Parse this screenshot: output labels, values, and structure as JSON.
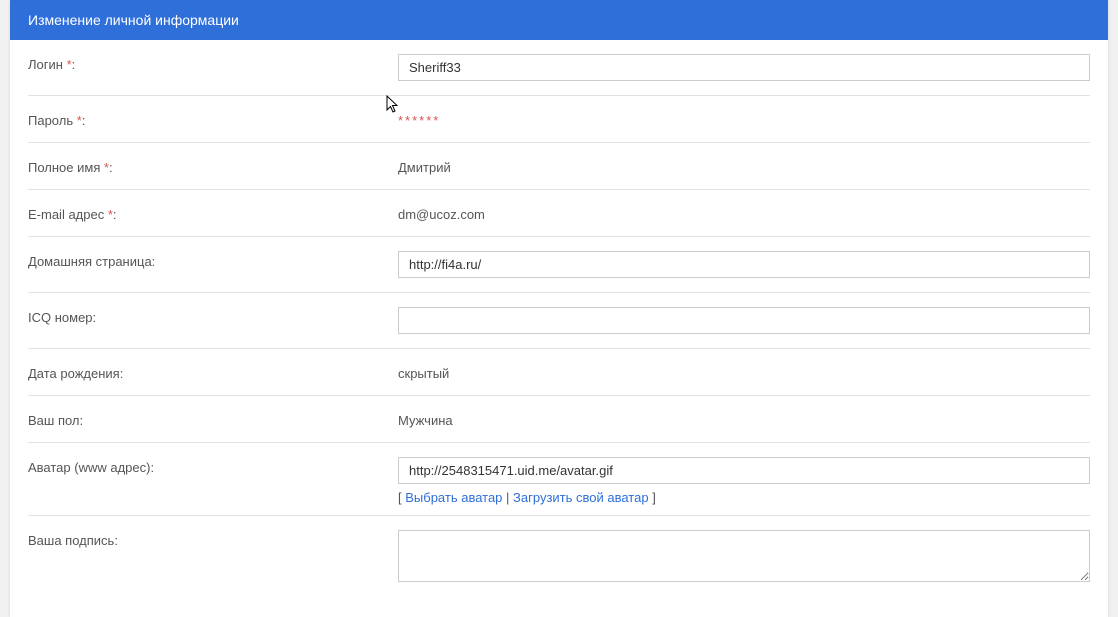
{
  "header": {
    "title": "Изменение личной информации"
  },
  "labels": {
    "login": "Логин",
    "password": "Пароль",
    "fullname": "Полное имя",
    "email": "E-mail адрес",
    "homepage": "Домашняя страница:",
    "icq": "ICQ номер:",
    "birthdate": "Дата рождения:",
    "gender": "Ваш пол:",
    "avatar": "Аватар (www адрес):",
    "signature": "Ваша подпись:",
    "star": " *",
    "colon": ":"
  },
  "values": {
    "login": "Sheriff33",
    "password_masked": "******",
    "fullname": "Дмитрий",
    "email": "dm@ucoz.com",
    "homepage": "http://fi4a.ru/",
    "icq": "",
    "birthdate": "скрытый",
    "gender": "Мужчина",
    "avatar": "http://2548315471.uid.me/avatar.gif",
    "signature": ""
  },
  "avatar_links": {
    "open_bracket": "[ ",
    "choose": "Выбрать аватар",
    "sep": " | ",
    "upload": "Загрузить свой аватар",
    "close_bracket": " ]"
  }
}
